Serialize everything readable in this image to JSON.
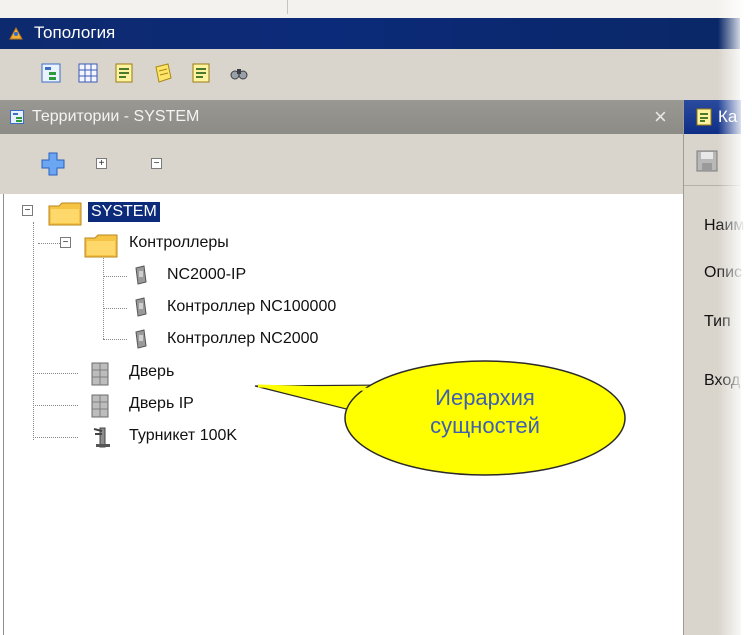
{
  "window": {
    "title": "Топология"
  },
  "toolbar": {
    "buttons": [
      {
        "icon": "tree-view-icon"
      },
      {
        "icon": "grid-icon"
      },
      {
        "icon": "card-icon"
      },
      {
        "icon": "notes-icon"
      },
      {
        "icon": "document-icon"
      },
      {
        "icon": "binoculars-icon"
      }
    ]
  },
  "left_panel": {
    "title": "Территории - SYSTEM",
    "close": "×",
    "tools": [
      {
        "icon": "add-icon"
      },
      {
        "icon": "expand-all-icon",
        "glyph": "+"
      },
      {
        "icon": "collapse-all-icon",
        "glyph": "−"
      }
    ],
    "tree": [
      {
        "label": "SYSTEM",
        "selected": true
      },
      {
        "label": "Контроллеры"
      },
      {
        "label": "NC2000-IP"
      },
      {
        "label": "Контроллер NC100000"
      },
      {
        "label": "Контроллер NC2000"
      },
      {
        "label": "Дверь"
      },
      {
        "label": "Дверь IP"
      },
      {
        "label": "Турникет 100K"
      }
    ]
  },
  "right_panel": {
    "title": "Ка",
    "fields": [
      "Наим",
      "Опис",
      "Тип",
      "Вход"
    ]
  },
  "callout": {
    "line1": "Иерархия",
    "line2": "сущностей"
  },
  "colors": {
    "titlebar": "#0b2a79",
    "selection": "#0b2a79",
    "panel_header": "#9a9892",
    "callout_fill": "#ffff00",
    "callout_text": "#3f5fb0"
  }
}
